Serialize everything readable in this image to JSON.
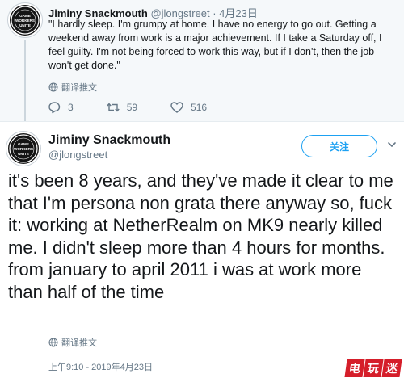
{
  "reply_tweet": {
    "author_name": "Jiminy Snackmouth",
    "author_meta": "@jlongstreet · 4月23日",
    "text": "\"I hardly sleep. I'm grumpy at home. I have no energy to go out. Getting a weekend away from work is a major achievement. If I take a Saturday off, I feel guilty. I'm not being forced to work this way, but if I don't, then the job won't get done.\"",
    "translate_label": "翻译推文",
    "replies": "3",
    "retweets": "59",
    "likes": "516",
    "avatar_text": "GAME WORKERS UNITE"
  },
  "main_tweet": {
    "author_name": "Jiminy Snackmouth",
    "author_handle": "@jlongstreet",
    "follow_label": "关注",
    "text": "it's been 8 years, and they've made it clear to me that I'm persona non grata there anyway so, fuck it: working at NetherRealm on MK9 nearly killed me. I didn't sleep more than 4 hours for months. from january to april 2011 i was at work more than half of the time",
    "translate_label": "翻译推文",
    "timestamp": "上午9:10 - 2019年4月23日",
    "avatar_text": "GAME WORKERS UNITE"
  },
  "watermark": [
    "电",
    "玩",
    "迷"
  ],
  "colors": {
    "accent": "#1da1f2",
    "muted": "#657786",
    "watermark": "#d51e2a"
  },
  "icons": [
    "globe-icon",
    "reply-icon",
    "retweet-icon",
    "like-icon",
    "chevron-down-icon"
  ]
}
